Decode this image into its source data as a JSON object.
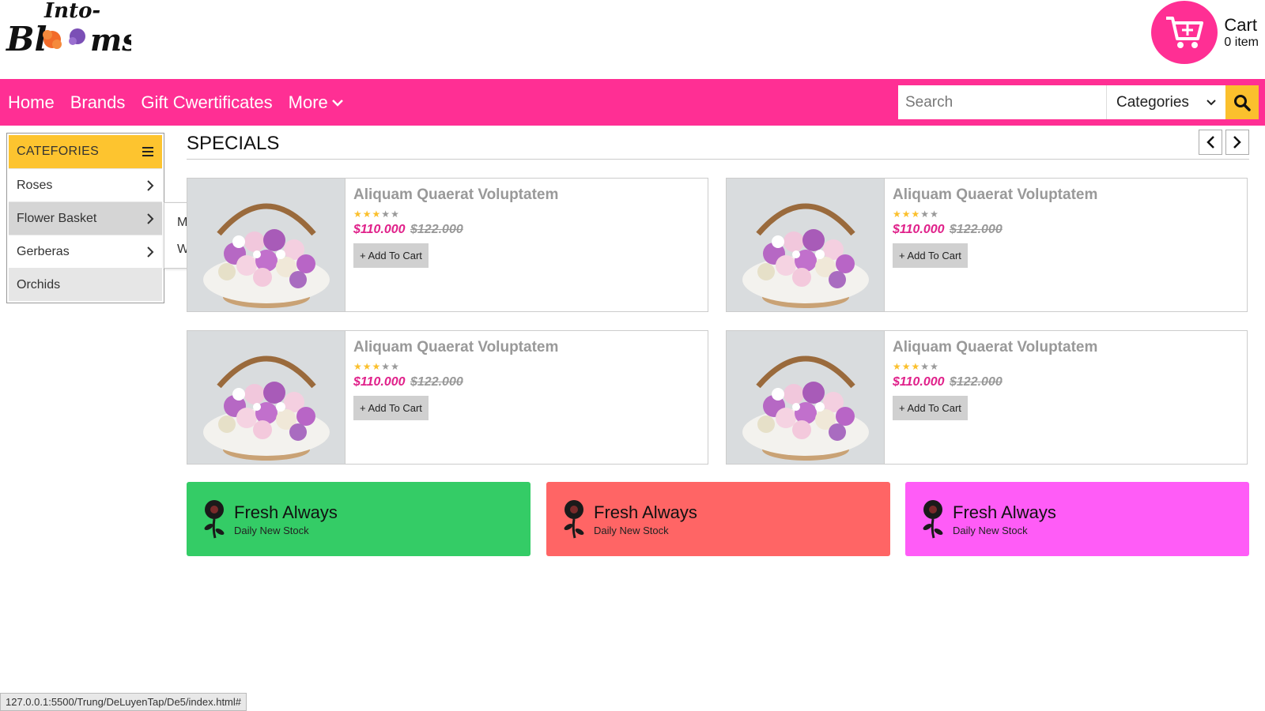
{
  "header": {
    "logo_alt": "Into-Blooms",
    "cart": {
      "title": "Cart",
      "count": "0 item",
      "icon": "cart-plus-icon"
    }
  },
  "nav": {
    "links": [
      "Home",
      "Brands",
      "Gift Cwertificates",
      "More"
    ],
    "search_placeholder": "Search",
    "category_select": "Categories",
    "search_icon": "search-icon"
  },
  "sidebar": {
    "heading": "CATEFORIES",
    "items": [
      "Roses",
      "Flower Basket",
      "Gerberas",
      "Orchids"
    ],
    "submenu": [
      "Macs",
      "Windows"
    ]
  },
  "specials": {
    "title": "SPECIALS",
    "products": [
      {
        "name": "Aliquam Quaerat Voluptatem",
        "rating": 3,
        "max_rating": 5,
        "price": "$110.000",
        "old_price": "$122.000",
        "button": "+ Add To Cart"
      },
      {
        "name": "Aliquam Quaerat Voluptatem",
        "rating": 3,
        "max_rating": 5,
        "price": "$110.000",
        "old_price": "$122.000",
        "button": "+ Add To Cart"
      },
      {
        "name": "Aliquam Quaerat Voluptatem",
        "rating": 3,
        "max_rating": 5,
        "price": "$110.000",
        "old_price": "$122.000",
        "button": "+ Add To Cart"
      },
      {
        "name": "Aliquam Quaerat Voluptatem",
        "rating": 3,
        "max_rating": 5,
        "price": "$110.000",
        "old_price": "$122.000",
        "button": "+ Add To Cart"
      }
    ]
  },
  "banners": [
    {
      "title": "Fresh Always",
      "subtitle": "Daily New Stock",
      "color": "#34cc66"
    },
    {
      "title": "Fresh Always",
      "subtitle": "Daily New Stock",
      "color": "#ff6565"
    },
    {
      "title": "Fresh Always",
      "subtitle": "Daily New Stock",
      "color": "#ff5cf7"
    }
  ],
  "status_url": "127.0.0.1:5500/Trung/DeLuyenTap/De5/index.html#",
  "colors": {
    "brand_pink": "#ff2f94",
    "accent_yellow": "#fdc42f"
  }
}
